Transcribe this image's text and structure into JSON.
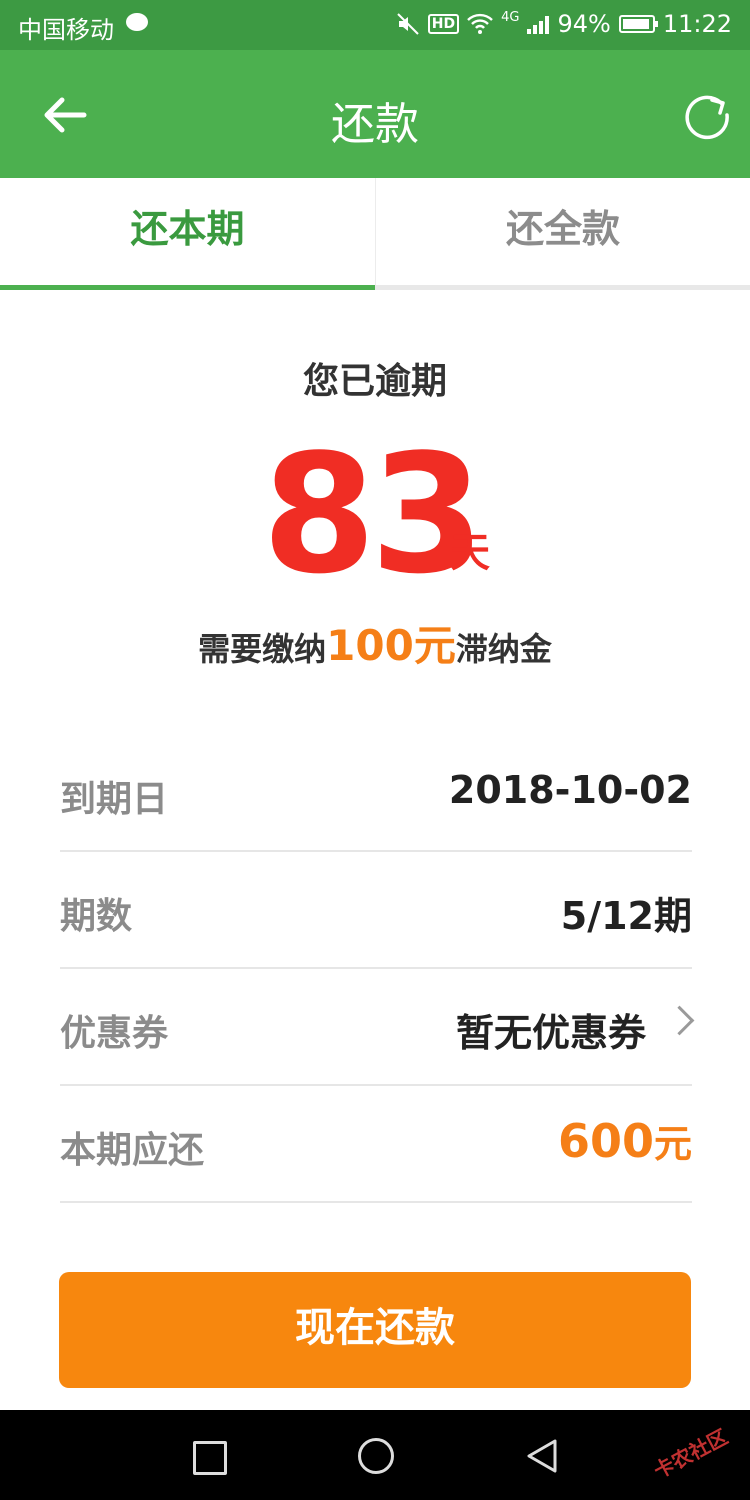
{
  "status_bar": {
    "carrier": "中国移动",
    "network": "4G",
    "battery": "94%",
    "time": "11:22"
  },
  "app_bar": {
    "title": "还款",
    "back_icon": "arrow-left-icon",
    "refresh_icon": "refresh-icon"
  },
  "tabs": [
    {
      "label": "还本期",
      "active": true
    },
    {
      "label": "还全款",
      "active": false
    }
  ],
  "overdue": {
    "label": "您已逾期",
    "days": "83",
    "days_unit": "天",
    "fee_prefix": "需要缴纳",
    "fee_amount": "100元",
    "fee_suffix": "滞纳金"
  },
  "details": [
    {
      "label": "到期日",
      "value": "2018-10-02"
    },
    {
      "label": "期数",
      "value": "5/12期"
    },
    {
      "label": "优惠券",
      "value": "暂无优惠券"
    },
    {
      "label": "本期应还",
      "value": "600",
      "unit": "元"
    }
  ],
  "pay_button": {
    "label": "现在还款"
  },
  "watermark": "卡农社区",
  "colors": {
    "primary_green": "#4cb04f",
    "overdue_red": "#f02d24",
    "accent_orange": "#f7870e"
  }
}
